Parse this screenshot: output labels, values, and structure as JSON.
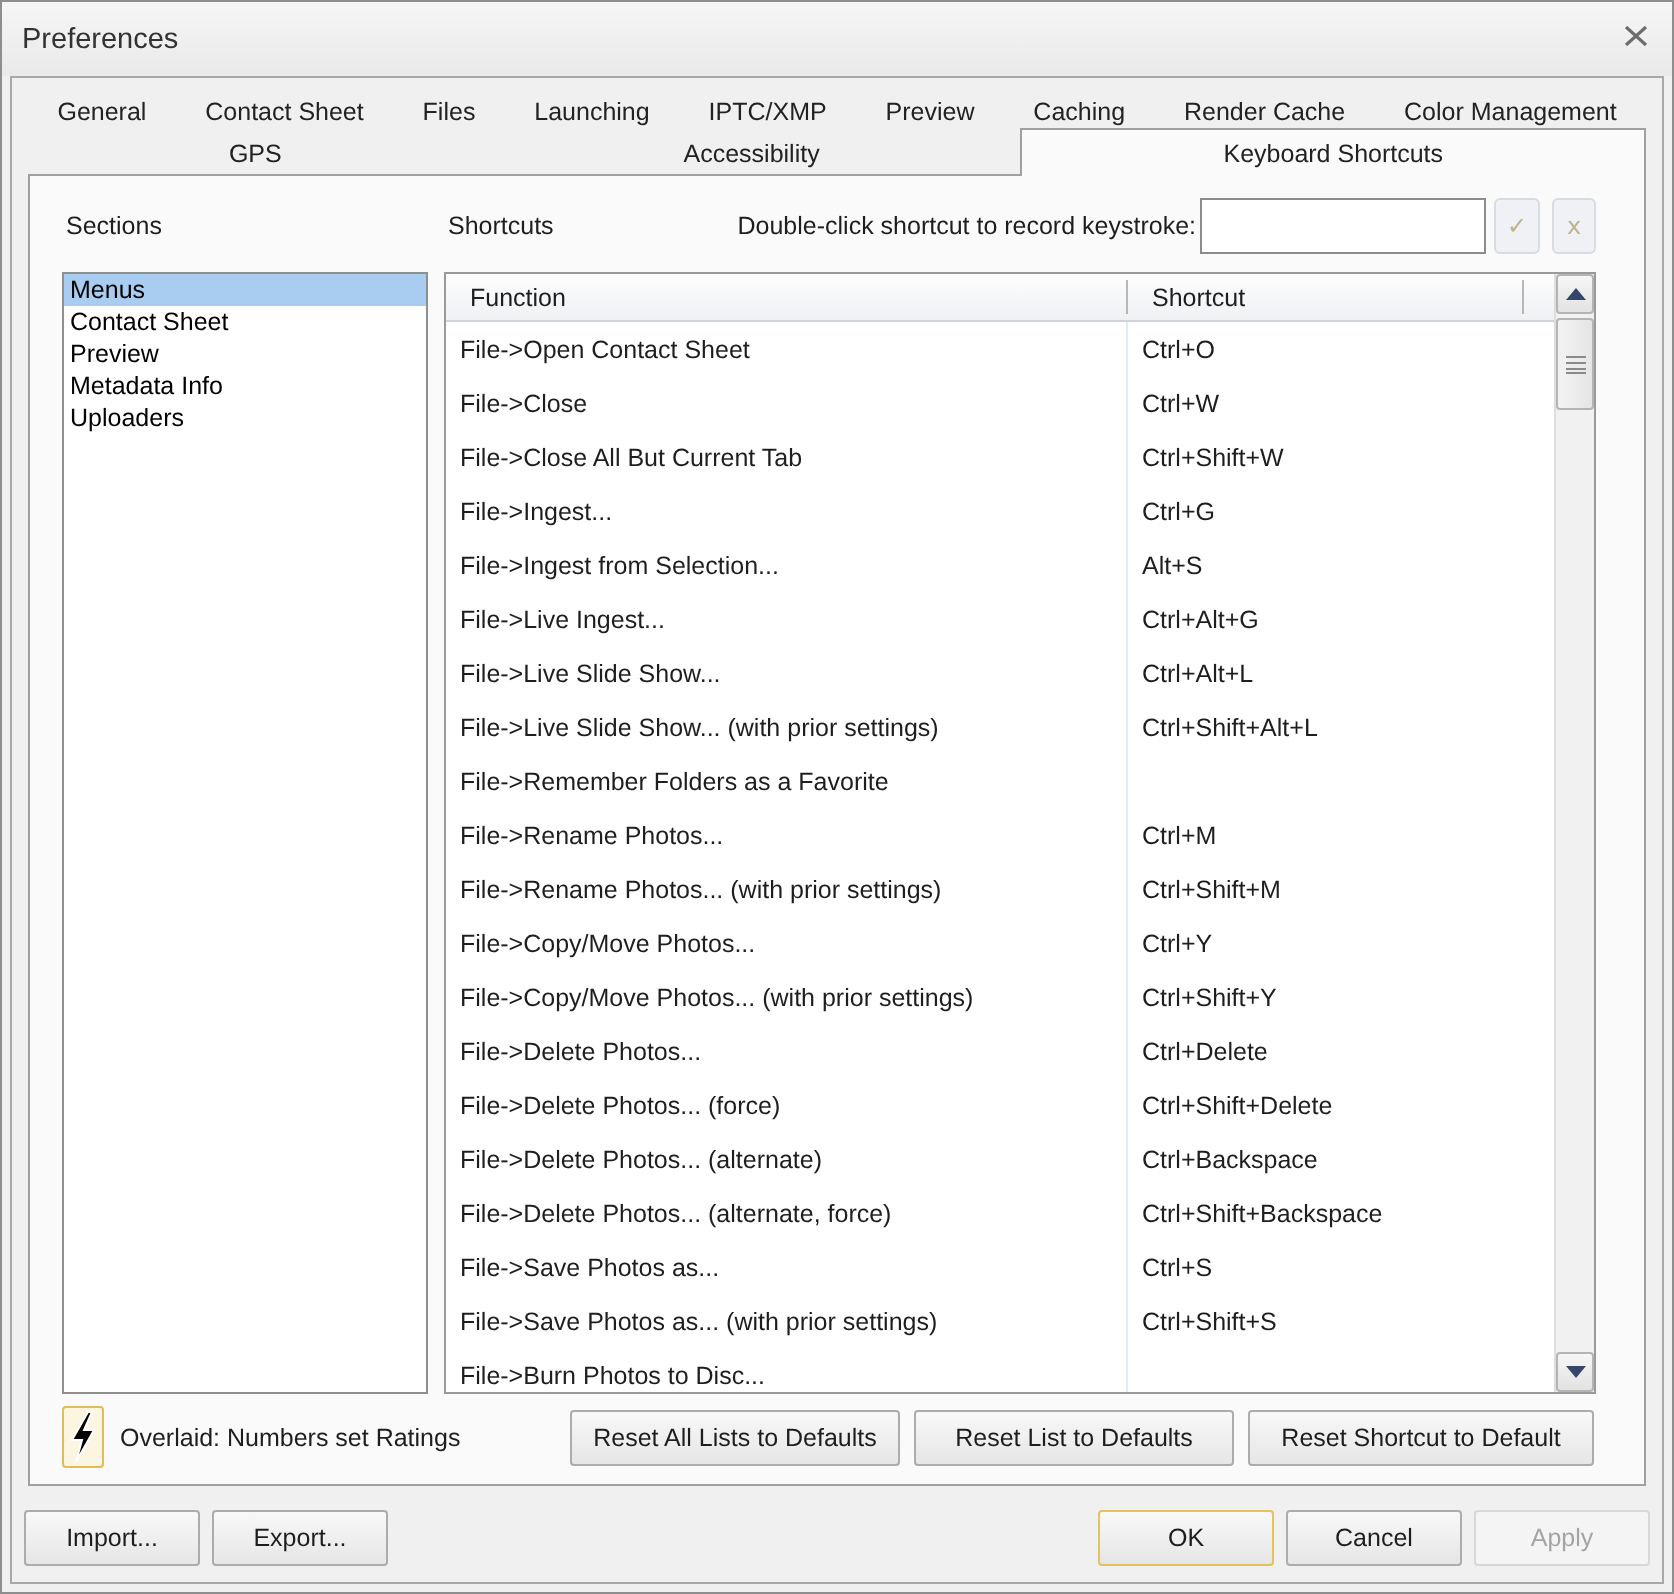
{
  "window": {
    "title": "Preferences"
  },
  "tab_rows": [
    {
      "tabs": [
        {
          "label": "General",
          "selected": false
        },
        {
          "label": "Contact Sheet",
          "selected": false
        },
        {
          "label": "Files",
          "selected": false
        },
        {
          "label": "Launching",
          "selected": false
        },
        {
          "label": "IPTC/XMP",
          "selected": false
        },
        {
          "label": "Preview",
          "selected": false
        },
        {
          "label": "Caching",
          "selected": false
        },
        {
          "label": "Render Cache",
          "selected": false
        },
        {
          "label": "Color Management",
          "selected": false
        }
      ]
    },
    {
      "tabs": [
        {
          "label": "GPS",
          "selected": false
        },
        {
          "label": "Accessibility",
          "selected": false
        },
        {
          "label": "Keyboard Shortcuts",
          "selected": true
        }
      ]
    }
  ],
  "sections": {
    "heading": "Sections",
    "items": [
      {
        "label": "Menus",
        "selected": true
      },
      {
        "label": "Contact Sheet",
        "selected": false
      },
      {
        "label": "Preview",
        "selected": false
      },
      {
        "label": "Metadata Info",
        "selected": false
      },
      {
        "label": "Uploaders",
        "selected": false
      }
    ]
  },
  "shortcuts": {
    "heading": "Shortcuts",
    "record_label": "Double-click shortcut to record keystroke:",
    "record_buttons": [
      {
        "label": "✓",
        "disabled": true
      },
      {
        "label": "x",
        "disabled": true
      }
    ],
    "table": {
      "columns": [
        "Function",
        "Shortcut"
      ],
      "rows": [
        {
          "function": "File->Open Contact Sheet",
          "shortcut": "Ctrl+O"
        },
        {
          "function": "File->Close",
          "shortcut": "Ctrl+W"
        },
        {
          "function": "File->Close All But Current Tab",
          "shortcut": "Ctrl+Shift+W"
        },
        {
          "function": "File->Ingest...",
          "shortcut": "Ctrl+G"
        },
        {
          "function": "File->Ingest from Selection...",
          "shortcut": "Alt+S"
        },
        {
          "function": "File->Live Ingest...",
          "shortcut": "Ctrl+Alt+G"
        },
        {
          "function": "File->Live Slide Show...",
          "shortcut": "Ctrl+Alt+L"
        },
        {
          "function": "File->Live Slide Show... (with prior settings)",
          "shortcut": "Ctrl+Shift+Alt+L"
        },
        {
          "function": "File->Remember Folders as a Favorite"
        },
        {
          "function": "File->Rename Photos...",
          "shortcut": "Ctrl+M"
        },
        {
          "function": "File->Rename Photos... (with prior settings)",
          "shortcut": "Ctrl+Shift+M"
        },
        {
          "function": "File->Copy/Move Photos...",
          "shortcut": "Ctrl+Y"
        },
        {
          "function": "File->Copy/Move Photos... (with prior settings)",
          "shortcut": "Ctrl+Shift+Y"
        },
        {
          "function": "File->Delete Photos...",
          "shortcut": "Ctrl+Delete"
        },
        {
          "function": "File->Delete Photos... (force)",
          "shortcut": "Ctrl+Shift+Delete"
        },
        {
          "function": "File->Delete Photos... (alternate)",
          "shortcut": "Ctrl+Backspace"
        },
        {
          "function": "File->Delete Photos... (alternate, force)",
          "shortcut": "Ctrl+Shift+Backspace"
        },
        {
          "function": "File->Save Photos as...",
          "shortcut": "Ctrl+S"
        },
        {
          "function": "File->Save Photos as... (with prior settings)",
          "shortcut": "Ctrl+Shift+S"
        },
        {
          "function": "File->Burn Photos to Disc..."
        }
      ]
    }
  },
  "overlay": {
    "text": "Overlaid: Numbers set Ratings",
    "focused": true
  },
  "reset_buttons": [
    "Reset All Lists to Defaults",
    "Reset List to Defaults",
    "Reset Shortcut to Default"
  ],
  "footer": {
    "left_buttons": [
      {
        "label": "Import...",
        "focused": false,
        "disabled": false
      },
      {
        "label": "Export...",
        "focused": false,
        "disabled": false
      }
    ],
    "right_buttons": [
      {
        "label": "OK",
        "focused": true,
        "disabled": false
      },
      {
        "label": "Cancel",
        "focused": false,
        "disabled": false
      },
      {
        "label": "Apply",
        "focused": false,
        "disabled": true
      }
    ]
  }
}
